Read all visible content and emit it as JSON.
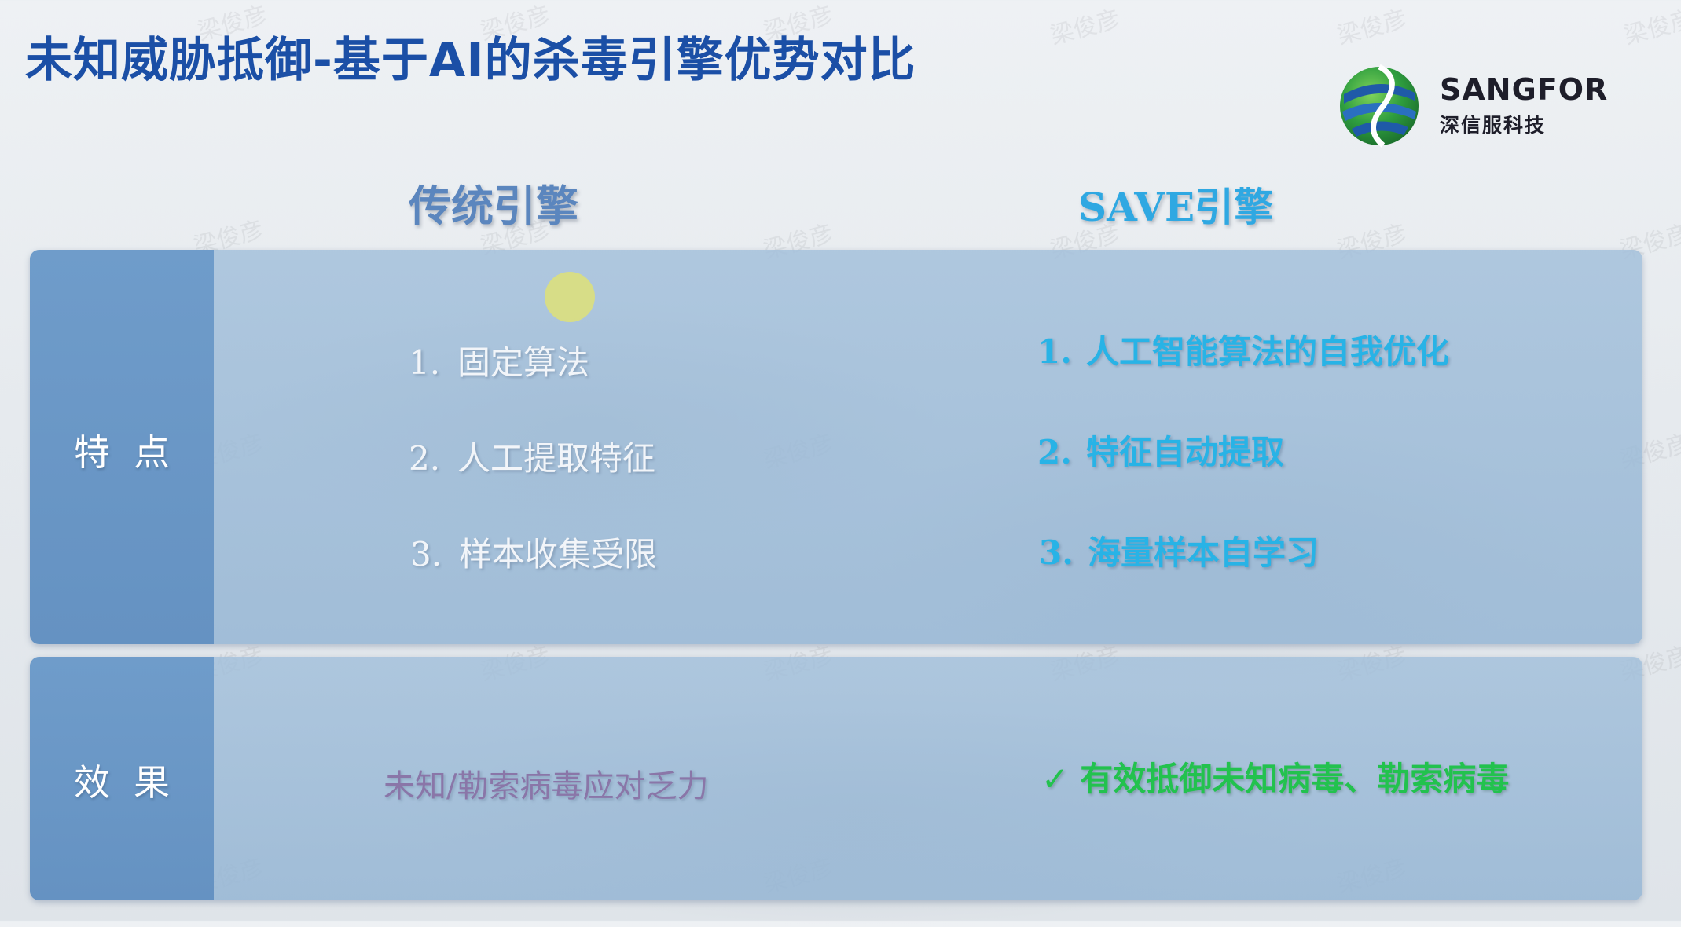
{
  "slide": {
    "title": "未知威胁抵御-基于AI的杀毒引擎优势对比",
    "watermark_text": "梁俊彦"
  },
  "logo": {
    "name": "SANGFOR",
    "subtitle": "深信服科技"
  },
  "columns": {
    "left_header": "传统引擎",
    "right_header": "SAVE引擎"
  },
  "rows": {
    "features_label": "特点",
    "effects_label": "效果"
  },
  "features": {
    "traditional": [
      {
        "num": "1.",
        "text": "固定算法"
      },
      {
        "num": "2.",
        "text": "人工提取特征"
      },
      {
        "num": "3.",
        "text": "样本收集受限"
      }
    ],
    "save": [
      {
        "num": "1.",
        "text": "人工智能算法的自我优化"
      },
      {
        "num": "2.",
        "text": "特征自动提取"
      },
      {
        "num": "3.",
        "text": "海量样本自学习"
      }
    ]
  },
  "effects": {
    "traditional": "未知/勒索病毒应对乏力",
    "save_check_icon": "checkmark-icon",
    "save": "有效抵御未知病毒、勒索病毒"
  },
  "colors": {
    "title": "#1b4fa6",
    "left_header": "#5b86be",
    "right_header": "#2fa8e2",
    "save_items": "#28b3e6",
    "effect_left": "#8a76a8",
    "effect_right": "#22c24e"
  }
}
